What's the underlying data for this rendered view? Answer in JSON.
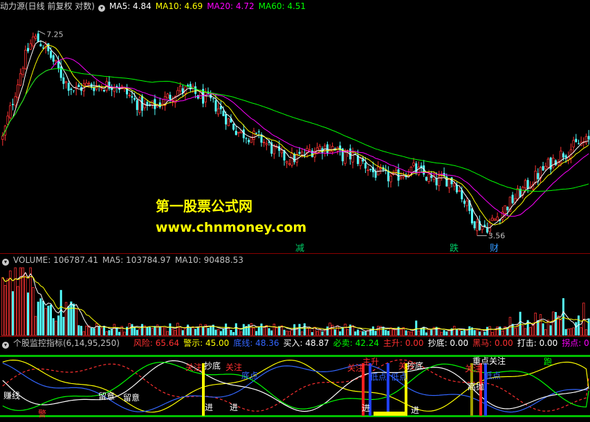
{
  "price_panel": {
    "title": "动力源(日线 前复权 对数)",
    "ma_labels": [
      {
        "text": "MA5: 4.84",
        "color": "#ffffff"
      },
      {
        "text": "MA10: 4.69",
        "color": "#ffff00"
      },
      {
        "text": "MA20: 4.72",
        "color": "#ff00ff"
      },
      {
        "text": "MA60: 4.51",
        "color": "#00ff00"
      }
    ],
    "high_label": "7.25",
    "low_label": "3.56",
    "watermark_title": "第一股票公式网",
    "watermark_url": "www.chnmoney.com",
    "event_labels": [
      {
        "text": "减",
        "color": "#00cc66"
      },
      {
        "text": "跌",
        "color": "#00cc66"
      },
      {
        "text": "财",
        "color": "#3399ff"
      }
    ]
  },
  "volume_panel": {
    "labels": [
      {
        "text": "VOLUME: 106787.41",
        "color": "#c0c0c0"
      },
      {
        "text": "MA5: 103784.97",
        "color": "#c0c0c0"
      },
      {
        "text": "MA10: 90488.53",
        "color": "#c0c0c0"
      }
    ]
  },
  "indicator_panel": {
    "title": "个股监控指标(6,14,95,250)",
    "labels": [
      {
        "text": "风险: 65.64",
        "color": "#ff3030"
      },
      {
        "text": "警示: 45.00",
        "color": "#ffff00"
      },
      {
        "text": "底线: 48.36",
        "color": "#3366ff"
      },
      {
        "text": "买入: 48.87",
        "color": "#ffffff"
      },
      {
        "text": "必卖: 42.24",
        "color": "#00ff00"
      },
      {
        "text": "主升: 0.00",
        "color": "#ff3030"
      },
      {
        "text": "抄底: 0.00",
        "color": "#ffffff"
      },
      {
        "text": "黑马: 0.00",
        "color": "#ff3030"
      },
      {
        "text": "打击: 0.00",
        "color": "#ffffff"
      },
      {
        "text": "拐点: 0",
        "color": "#ff00ff"
      }
    ],
    "signal_labels": [
      {
        "text": "赚线",
        "color": "#ffffff"
      },
      {
        "text": "警",
        "color": "#ff3030"
      },
      {
        "text": "留意",
        "color": "#ffffff"
      },
      {
        "text": "留意",
        "color": "#ffffff"
      },
      {
        "text": "关注",
        "color": "#ff3030"
      },
      {
        "text": "抄底",
        "color": "#ffffff"
      },
      {
        "text": "关注",
        "color": "#ff3030"
      },
      {
        "text": "进",
        "color": "#ffffff"
      },
      {
        "text": "进",
        "color": "#ffffff"
      },
      {
        "text": "底点",
        "color": "#3366ff"
      },
      {
        "text": "主升",
        "color": "#ff3030"
      },
      {
        "text": "关注",
        "color": "#ff3030"
      },
      {
        "text": "进",
        "color": "#ffffff"
      },
      {
        "text": "低点",
        "color": "#3366ff"
      },
      {
        "text": "低点",
        "color": "#3366ff"
      },
      {
        "text": "关注",
        "color": "#ff3030"
      },
      {
        "text": "抄底",
        "color": "#ffffff"
      },
      {
        "text": "进",
        "color": "#ffffff"
      },
      {
        "text": "重点关注",
        "color": "#ffffff"
      },
      {
        "text": "关注",
        "color": "#ff3030"
      },
      {
        "text": "低点",
        "color": "#3366ff"
      },
      {
        "text": "高抛",
        "color": "#ffffff"
      },
      {
        "text": "跑",
        "color": "#00ff00"
      }
    ]
  },
  "chart_data": [
    {
      "type": "candlestick",
      "title": "动力源(日线 前复权 对数)",
      "scale": "log",
      "ylim": [
        3.3,
        7.6
      ],
      "x": "trading days (unlabeled)",
      "close_path": [
        4.9,
        5.6,
        6.4,
        7.0,
        6.8,
        6.4,
        6.0,
        5.8,
        5.9,
        5.9,
        5.9,
        5.95,
        5.75,
        5.55,
        5.45,
        5.5,
        5.65,
        5.8,
        5.8,
        5.7,
        5.6,
        5.45,
        5.2,
        5.0,
        4.95,
        4.9,
        4.75,
        4.6,
        4.55,
        4.6,
        4.7,
        4.75,
        4.75,
        4.6,
        4.6,
        4.5,
        4.35,
        4.3,
        4.25,
        4.35,
        4.4,
        4.3,
        4.2,
        4.25,
        4.2,
        3.9,
        3.62,
        3.58,
        3.7,
        3.85,
        4.0,
        4.15,
        4.3,
        4.45,
        4.6,
        4.7,
        4.8,
        4.85
      ],
      "ma_series": [
        {
          "name": "MA5",
          "color": "#ffffff",
          "last": 4.84
        },
        {
          "name": "MA10",
          "color": "#ffff00",
          "last": 4.69
        },
        {
          "name": "MA20",
          "color": "#ff00ff",
          "last": 4.72
        },
        {
          "name": "MA60",
          "color": "#00ff00",
          "last": 4.51
        }
      ],
      "annotations": [
        {
          "text": "7.25",
          "value": 7.25,
          "kind": "high"
        },
        {
          "text": "3.56",
          "value": 3.56,
          "kind": "low"
        }
      ]
    },
    {
      "type": "bar",
      "title": "VOLUME",
      "series": [
        {
          "name": "VOLUME",
          "last": 106787.41
        },
        {
          "name": "MA5",
          "last": 103784.97
        },
        {
          "name": "MA10",
          "last": 90488.53
        }
      ]
    },
    {
      "type": "line",
      "title": "个股监控指标(6,14,95,250)",
      "ylim": [
        0,
        100
      ],
      "series": [
        {
          "name": "风险",
          "color": "#ff3030",
          "last": 65.64
        },
        {
          "name": "警示",
          "color": "#ffff00",
          "last": 45.0
        },
        {
          "name": "底线",
          "color": "#3366ff",
          "last": 48.36
        },
        {
          "name": "买入",
          "color": "#ffffff",
          "last": 48.87
        },
        {
          "name": "必卖",
          "color": "#00ff00",
          "last": 42.24
        }
      ]
    }
  ]
}
